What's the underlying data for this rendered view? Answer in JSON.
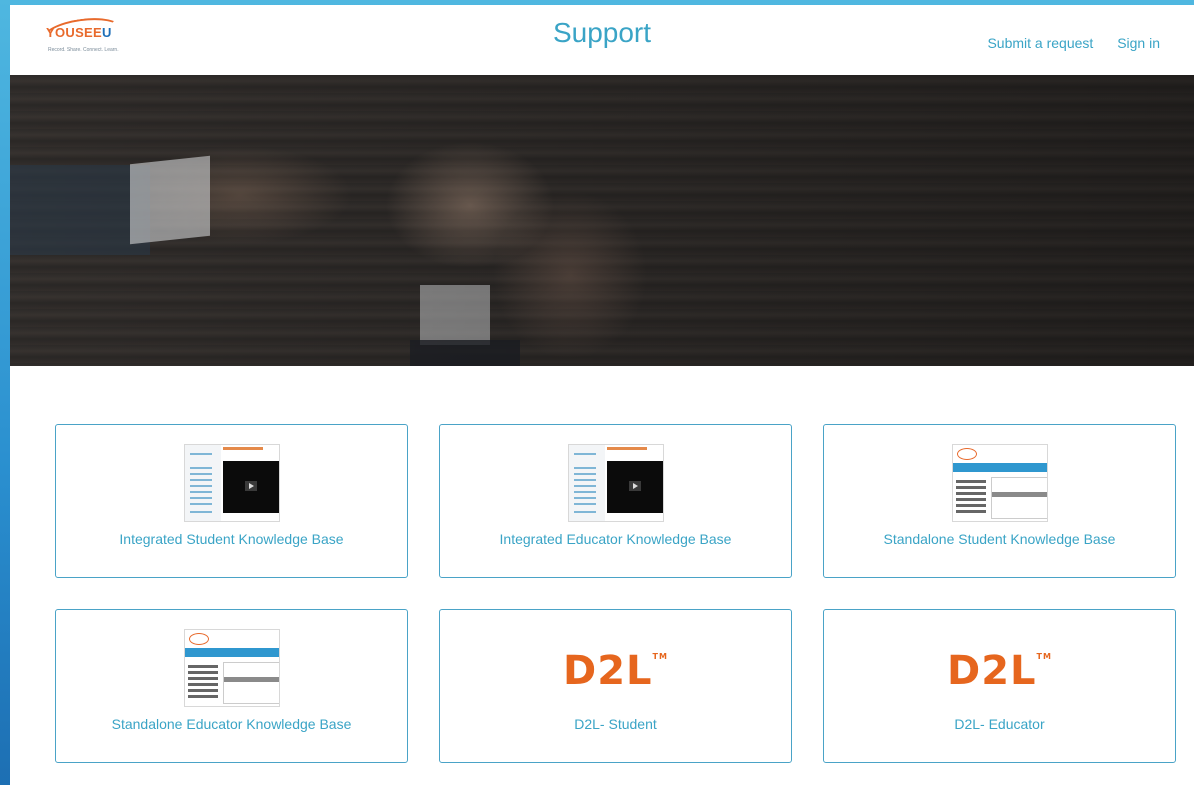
{
  "header": {
    "logo_text_you": "YOUSEE",
    "logo_text_u": "U",
    "logo_tagline": "Record. Share. Connect. Learn.",
    "title": "Support",
    "nav": [
      "Submit a request",
      "Sign in"
    ]
  },
  "cards": [
    {
      "label": "Integrated Student Knowledge Base",
      "thumb": "video-screenshot"
    },
    {
      "label": "Integrated Educator Knowledge Base",
      "thumb": "video-screenshot"
    },
    {
      "label": "Standalone Student Knowledge Base",
      "thumb": "app-screenshot"
    },
    {
      "label": "Standalone Educator Knowledge Base",
      "thumb": "app-screenshot"
    },
    {
      "label": "D2L- Student",
      "thumb": "d2l-logo",
      "logo_text": "D2L",
      "tm": "TM"
    },
    {
      "label": "D2L- Educator",
      "thumb": "d2l-logo",
      "logo_text": "D2L",
      "tm": "TM"
    }
  ],
  "colors": {
    "accent": "#3aa4c6",
    "d2l": "#e6661e",
    "logo_orange": "#e86a2c",
    "logo_blue": "#1f6fb8"
  }
}
